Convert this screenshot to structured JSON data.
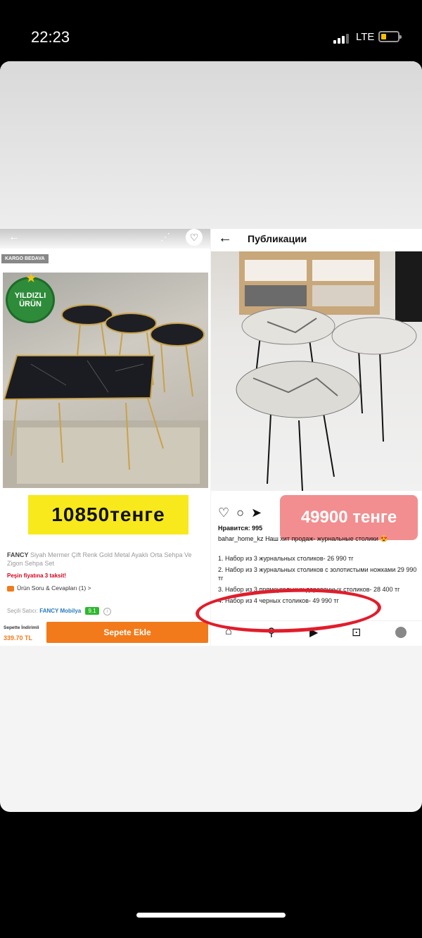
{
  "status_bar": {
    "time": "22:23",
    "network": "LTE"
  },
  "left_screen": {
    "kargo_badge": "KARGO BEDAVA",
    "badge_line1": "YILDIZLI",
    "badge_line2": "ÜRÜN",
    "price_overlay": "10850тенге",
    "brand": "FANCY",
    "title": "Siyah Mermer Çift Renk Gold Metal Ayaklı Orta Sehpa Ve Zigon Sehpa Set",
    "installment": "Peşin fiyatına 3 taksit!",
    "qa_link": "Ürün Soru & Cevapları (1) >",
    "seller_label": "Seçili Satıcı:",
    "seller_name": "FANCY Mobilya",
    "seller_rating": "9.1",
    "discount_label": "Sepette İndirimli",
    "discount_price": "339.70 TL",
    "add_to_cart": "Sepete Ekle"
  },
  "right_screen": {
    "header_title": "Публикации",
    "price_overlay": "49900 тенге",
    "likes": "Нравится: 995",
    "username": "bahar_home_kz",
    "caption": "Наш хит продаж- журнальные столики 😍",
    "items": [
      "1. Набор из 3 журнальных столиков- 26 990 тг",
      "2. Набор из 3 журнальных столиков с золотистыми ножками 29 990 тг",
      "3. Набор из 3 прямоугольных деревянных столиков- 28 400 тг",
      "4. Набор из 4 черных столиков- 49 990 тг"
    ]
  }
}
